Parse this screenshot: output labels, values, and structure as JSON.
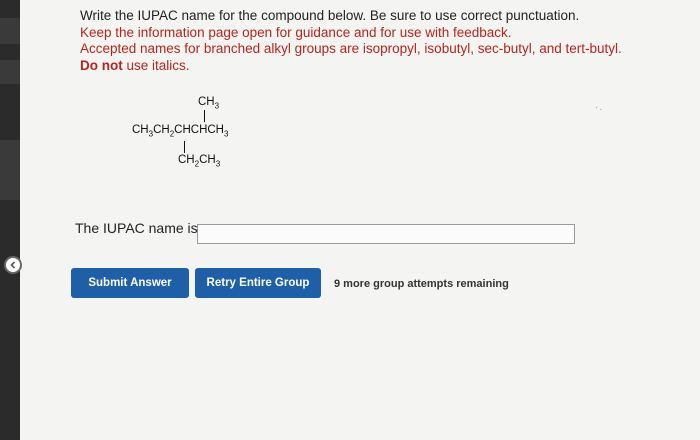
{
  "instructions": {
    "line1": "Write the IUPAC name for the compound below. Be sure to use correct punctuation.",
    "line2": "Keep the information page open for guidance and for use with feedback.",
    "line3": "Accepted names for branched alkyl groups are isopropyl, isobutyl, sec-butyl, and tert-butyl.",
    "line4_bold": "Do not",
    "line4_rest": " use italics."
  },
  "structure": {
    "top_group": "CH3",
    "main_chain": "CH3CH2CHCHCH3",
    "bottom_group": "CH2CH3"
  },
  "answer": {
    "label": "The IUPAC name is",
    "value": "",
    "placeholder": ""
  },
  "buttons": {
    "submit": "Submit Answer",
    "retry": "Retry Entire Group"
  },
  "attempts_text": "9 more group attempts remaining",
  "colors": {
    "button_blue": "#1f5fa8",
    "instruction_red": "#b3261e"
  },
  "icons": {
    "collapse": "chevron-left-icon"
  }
}
